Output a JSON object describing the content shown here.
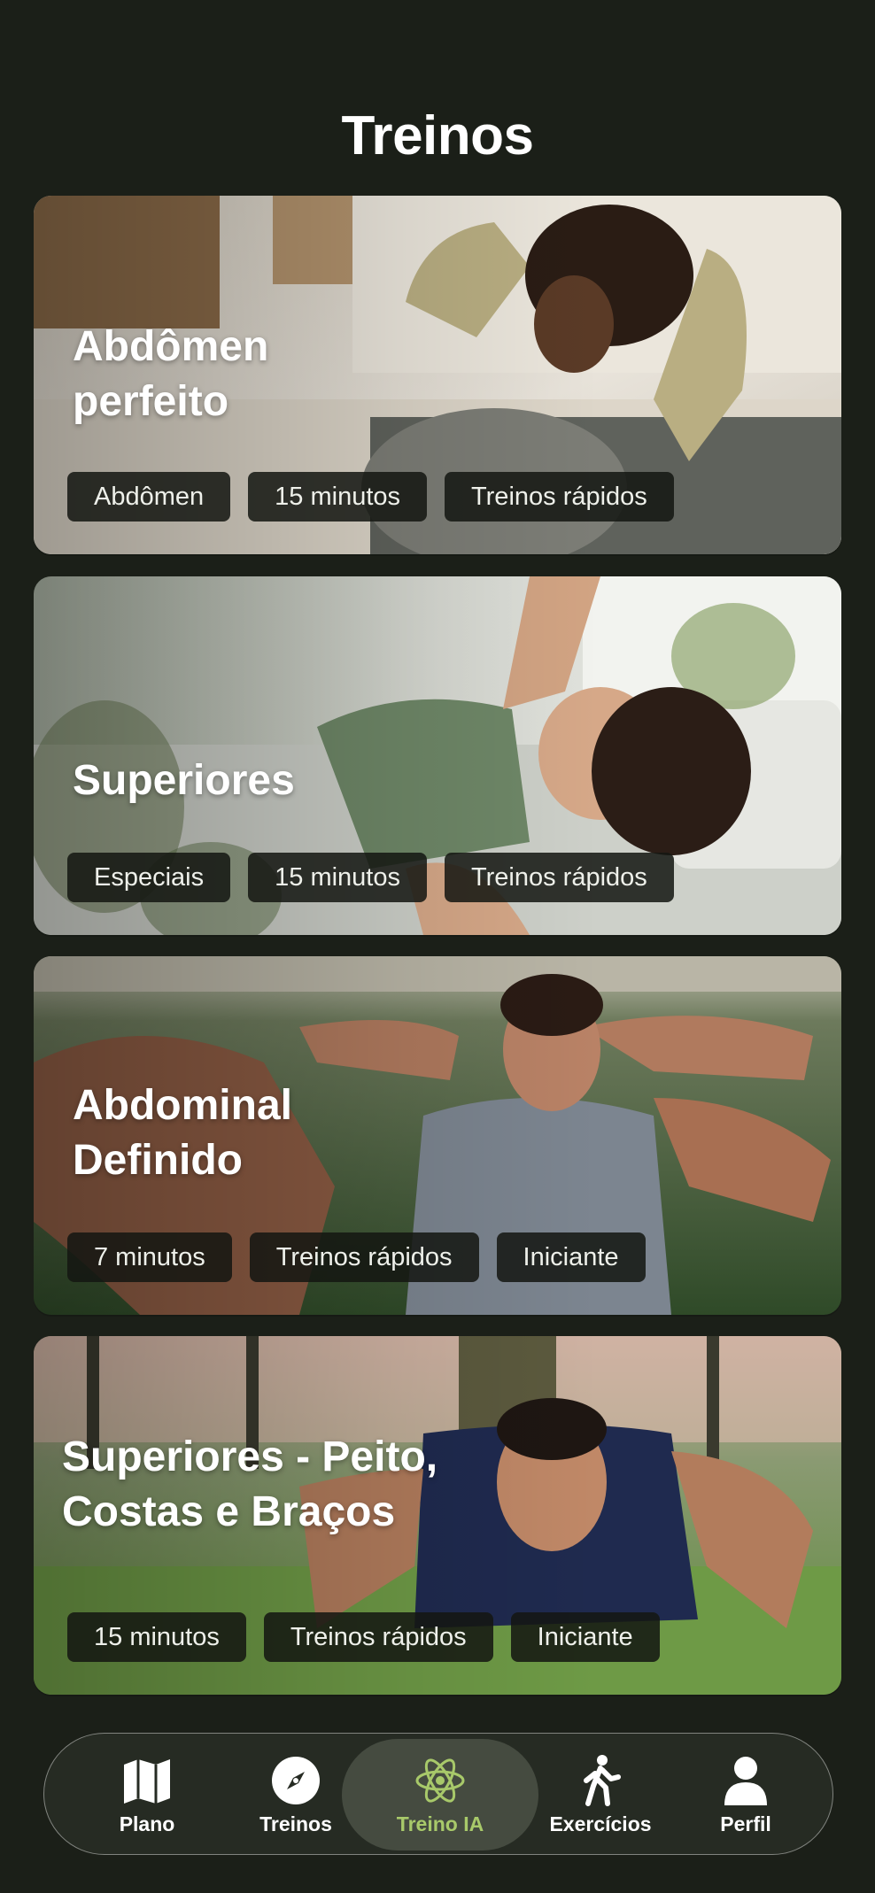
{
  "page": {
    "title": "Treinos"
  },
  "cards": [
    {
      "title_line1": "Abdômen",
      "title_line2": "perfeito",
      "tags": [
        "Abdômen",
        "15 minutos",
        "Treinos rápidos"
      ]
    },
    {
      "title_line1": "Superiores",
      "title_line2": "",
      "tags": [
        "Especiais",
        "15 minutos",
        "Treinos rápidos"
      ]
    },
    {
      "title_line1": "Abdominal",
      "title_line2": "Definido",
      "tags": [
        "7 minutos",
        "Treinos rápidos",
        "Iniciante"
      ]
    },
    {
      "title_line1": "Superiores - Peito,",
      "title_line2": "Costas e Braços",
      "tags": [
        "15 minutos",
        "Treinos rápidos",
        "Iniciante"
      ]
    }
  ],
  "nav": {
    "active": "Treino IA",
    "items": [
      {
        "label": "Plano",
        "icon": "map-icon"
      },
      {
        "label": "Treinos",
        "icon": "compass-icon"
      },
      {
        "label": "Treino IA",
        "icon": "atom-icon"
      },
      {
        "label": "Exercícios",
        "icon": "walking-figure-icon"
      },
      {
        "label": "Perfil",
        "icon": "person-icon"
      }
    ]
  },
  "colors": {
    "background": "#1b1f18",
    "accent": "#a8c96a",
    "chip_bg": "#141612"
  }
}
